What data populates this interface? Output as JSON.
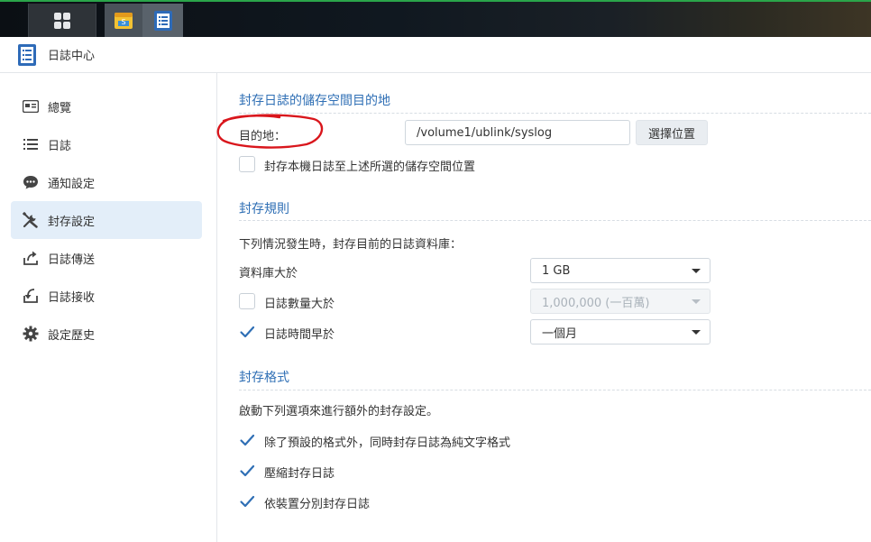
{
  "window": {
    "title": "日誌中心"
  },
  "taskbar": {
    "main_menu_icon": "grid-icon",
    "apps": [
      "storage-app-icon",
      "log-center-app-icon"
    ]
  },
  "sidebar": {
    "items": [
      {
        "label": "總覽",
        "icon": "overview-icon",
        "active": false
      },
      {
        "label": "日誌",
        "icon": "list-icon",
        "active": false
      },
      {
        "label": "通知設定",
        "icon": "chat-bubble-icon",
        "active": false
      },
      {
        "label": "封存設定",
        "icon": "tools-icon",
        "active": true
      },
      {
        "label": "日誌傳送",
        "icon": "upload-icon",
        "active": false
      },
      {
        "label": "日誌接收",
        "icon": "download-icon",
        "active": false
      },
      {
        "label": "設定歷史",
        "icon": "gear-icon",
        "active": false
      }
    ]
  },
  "destination": {
    "title": "封存日誌的儲存空間目的地",
    "label": "目的地：",
    "path_value": "/volume1/ublink/syslog",
    "choose_button": "選擇位置",
    "local_checkbox_label": "封存本機日誌至上述所選的儲存空間位置",
    "local_checked": false
  },
  "rules": {
    "title": "封存規則",
    "description": "下列情況發生時，封存目前的日誌資料庫：",
    "db_size_label": "資料庫大於",
    "db_size_value": "1 GB",
    "count_label": "日誌數量大於",
    "count_checked": false,
    "count_value": "1,000,000 (一百萬)",
    "time_label": "日誌時間早於",
    "time_checked": true,
    "time_value": "一個月"
  },
  "format": {
    "title": "封存格式",
    "description": "啟動下列選項來進行額外的封存設定。",
    "options": [
      {
        "label": "除了預設的格式外，同時封存日誌為純文字格式",
        "checked": true
      },
      {
        "label": "壓縮封存日誌",
        "checked": true
      },
      {
        "label": "依裝置分別封存日誌",
        "checked": true
      }
    ]
  },
  "colors": {
    "accent": "#2f6fb5",
    "active_bg": "#e3eef9",
    "check": "#2f6fb5",
    "annotation": "#d9161c"
  }
}
